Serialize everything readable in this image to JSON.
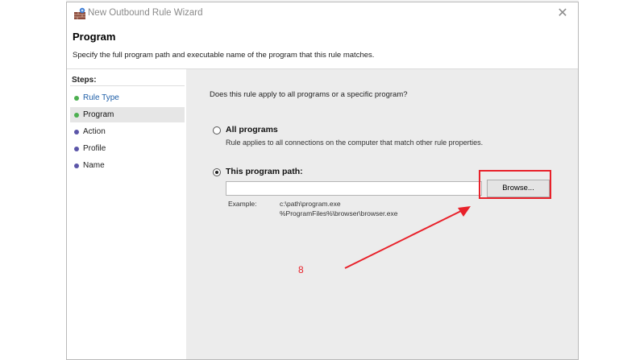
{
  "window": {
    "title": "New Outbound Rule Wizard",
    "close_glyph": "✕"
  },
  "header": {
    "title": "Program",
    "description": "Specify the full program path and executable name of the program that this rule matches."
  },
  "sidebar": {
    "steps_label": "Steps:",
    "steps": [
      {
        "label": "Rule Type",
        "status": "completed",
        "dot_color": "#4caf50",
        "text_color": "#1f5fa8"
      },
      {
        "label": "Program",
        "status": "current",
        "dot_color": "#4caf50",
        "text_color": "#111111"
      },
      {
        "label": "Action",
        "status": "pending",
        "dot_color": "#5b55a8",
        "text_color": "#222222"
      },
      {
        "label": "Profile",
        "status": "pending",
        "dot_color": "#5b55a8",
        "text_color": "#222222"
      },
      {
        "label": "Name",
        "status": "pending",
        "dot_color": "#5b55a8",
        "text_color": "#222222"
      }
    ]
  },
  "content": {
    "question": "Does this rule apply to all programs or a specific program?",
    "option_all": {
      "label": "All programs",
      "description": "Rule applies to all connections on the computer that match other rule properties.",
      "selected": false
    },
    "option_path": {
      "label": "This program path:",
      "selected": true,
      "input_value": "",
      "browse_label": "Browse..."
    },
    "example": {
      "label": "Example:",
      "lines": [
        "c:\\path\\program.exe",
        "%ProgramFiles%\\browser\\browser.exe"
      ]
    }
  },
  "annotation": {
    "number": "8",
    "color": "#e8212a"
  }
}
